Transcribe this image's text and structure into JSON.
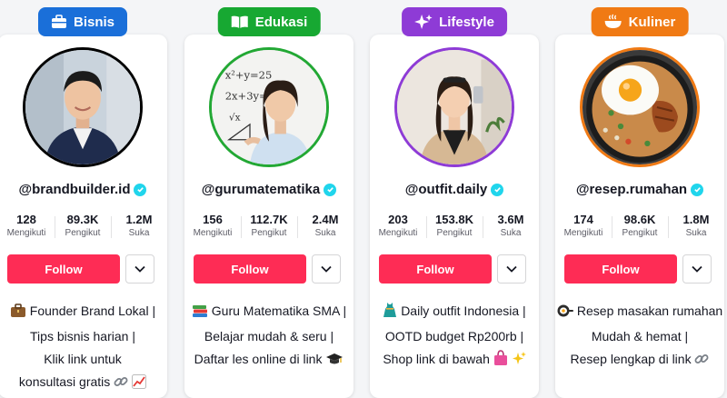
{
  "profiles": [
    {
      "category": "Bisnis",
      "category_icon": "briefcase-icon",
      "color": "#1a6fd9",
      "ring_color": "#000000",
      "handle": "@brandbuilder.id",
      "stats": [
        {
          "value": "128",
          "label": "Mengikuti"
        },
        {
          "value": "89.3K",
          "label": "Pengikut"
        },
        {
          "value": "1.2M",
          "label": "Suka"
        }
      ],
      "follow_label": "Follow",
      "bio": [
        {
          "text": "Founder Brand Lokal |",
          "lead_icon": "briefcase-emoji"
        },
        {
          "text": "Tips bisnis harian |"
        },
        {
          "text": "Klik link untuk"
        },
        {
          "text": "konsultasi gratis",
          "trail_icons": [
            "link-emoji",
            "chart-emoji"
          ]
        }
      ]
    },
    {
      "category": "Edukasi",
      "category_icon": "book-icon",
      "color": "#17a832",
      "ring_color": "#22a834",
      "handle": "@gurumatematika",
      "stats": [
        {
          "value": "156",
          "label": "Mengikuti"
        },
        {
          "value": "112.7K",
          "label": "Pengikut"
        },
        {
          "value": "2.4M",
          "label": "Suka"
        }
      ],
      "follow_label": "Follow",
      "bio": [
        {
          "text": "Guru Matematika SMA |",
          "lead_icon": "books-emoji"
        },
        {
          "text": "Belajar mudah & seru |"
        },
        {
          "text": "Daftar les online di link",
          "trail_icons": [
            "graduation-cap-emoji"
          ]
        }
      ]
    },
    {
      "category": "Lifestyle",
      "category_icon": "sparkle-icon",
      "color": "#8e3bd6",
      "ring_color": "#8e3bd6",
      "handle": "@outfit.daily",
      "stats": [
        {
          "value": "203",
          "label": "Mengikuti"
        },
        {
          "value": "153.8K",
          "label": "Pengikut"
        },
        {
          "value": "3.6M",
          "label": "Suka"
        }
      ],
      "follow_label": "Follow",
      "bio": [
        {
          "text": "Daily outfit Indonesia |",
          "lead_icon": "dress-emoji"
        },
        {
          "text": "OOTD budget Rp200rb |"
        },
        {
          "text": "Shop link di bawah",
          "trail_icons": [
            "shopping-bag-emoji",
            "sparkles-emoji"
          ]
        }
      ]
    },
    {
      "category": "Kuliner",
      "category_icon": "bowl-icon",
      "color": "#f07a14",
      "ring_color": "#f07a14",
      "handle": "@resep.rumahan",
      "stats": [
        {
          "value": "174",
          "label": "Mengikuti"
        },
        {
          "value": "98.6K",
          "label": "Pengikut"
        },
        {
          "value": "1.8M",
          "label": "Suka"
        }
      ],
      "follow_label": "Follow",
      "bio": [
        {
          "text": "Resep masakan rumahan |",
          "lead_icon": "frying-pan-emoji"
        },
        {
          "text": "Mudah & hemat |"
        },
        {
          "text": "Resep lengkap di link",
          "trail_icons": [
            "link-emoji"
          ]
        }
      ]
    }
  ]
}
